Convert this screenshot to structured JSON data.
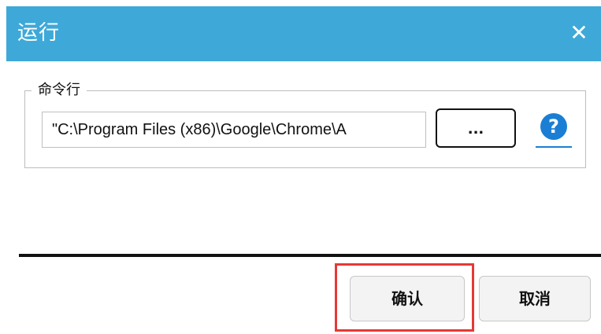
{
  "window": {
    "title": "运行",
    "close_glyph": "✕"
  },
  "group": {
    "label": "命令行",
    "command_value": "\"C:\\Program Files (x86)\\Google\\Chrome\\A",
    "browse_label": "...",
    "help_glyph": "?"
  },
  "footer": {
    "ok_label": "确认",
    "cancel_label": "取消"
  },
  "colors": {
    "titlebar": "#3ea9d8",
    "help": "#1a7fd4",
    "highlight": "#e53935"
  },
  "icons": {
    "close": "close-icon",
    "help": "help-icon"
  }
}
